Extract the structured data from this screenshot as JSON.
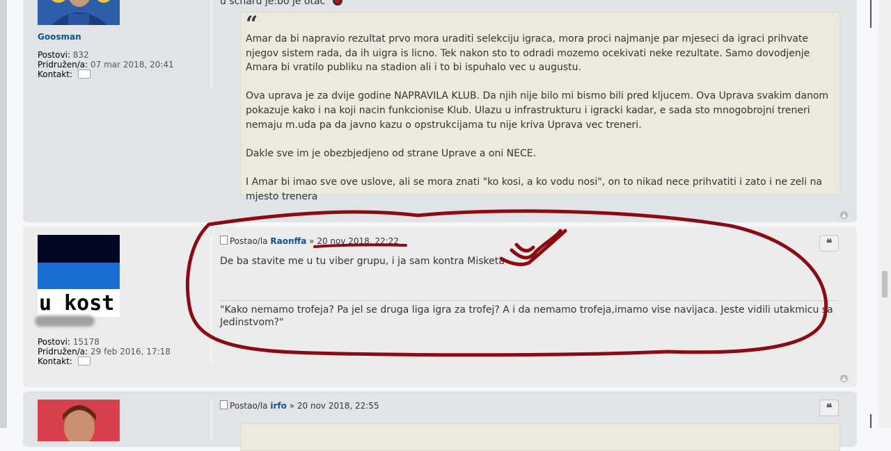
{
  "post1": {
    "header_fragment": "u scnaru je:bo je otac",
    "username": "Goosman",
    "stats": [
      {
        "label": "Postovi:",
        "value": "832"
      },
      {
        "label": "Pridružen/a:",
        "value": "07 mar 2018, 20:41"
      },
      {
        "label": "Kontakt:",
        "value": ""
      }
    ],
    "quote_mark": "“",
    "quote_paragraphs": [
      "Amar da bi napravio rezultat prvo mora uraditi selekciju igraca, mora proci najmanje par mjeseci da igraci prihvate njegov sistem rada, da ih uigra is licno. Tek nakon sto to odradi mozemo ocekivati neke rezultate. Samo dovodjenje Amara bi vratilo publiku na stadion ali i to bi ispuhalo vec u augustu.",
      "Ova uprava je za dvije godine NAPRAVILA KLUB. Da njih nije bilo mi bismo bili pred kljucem. Ova Uprava svakim danom pokazuje kako i na koji nacin funkcionise Klub. Ulazu u infrastrukturu i igracki kadar, e sada sto mnogobrojni treneri nemaju m.uda pa da javno kazu o opstrukcijama tu nije kriva Uprava vec treneri.",
      "Dakle sve im je obezbjedjeno od strane Uprave a oni NECE.",
      "I Amar bi imao sve ove uslove, ali se mora znati \"ko kosi, a ko vodu nosi\", on to nikad nece prihvatiti i zato i ne zeli na mjesto trenera"
    ]
  },
  "post2": {
    "avatar_text": "u kost",
    "stats": [
      {
        "label": "Postovi:",
        "value": "15178"
      },
      {
        "label": "Pridružen/a:",
        "value": "29 feb 2016, 17:18"
      },
      {
        "label": "Kontakt:",
        "value": ""
      }
    ],
    "posted_by": "Postao/la",
    "author": "Raonffa",
    "sep": "»",
    "date": "20 nov 2018, 22:22",
    "content": "De ba stavite me u tu viber grupu, i ja sam kontra Misketa",
    "signature": "\"Kako nemamo trofeja? Pa jel se druga liga igra za trofej? A i da nemamo trofeja,imamo vise navijaca. Jeste vidili utakmicu sa Jedinstvom?\""
  },
  "post3": {
    "posted_by": "Postao/la",
    "author": "irfo",
    "sep": "»",
    "date": "20 nov 2018, 22:55"
  },
  "buttons": {
    "quote": "❝",
    "top": "▲"
  },
  "colors": {
    "annotation": "#8b0a14",
    "link": "#105289"
  }
}
